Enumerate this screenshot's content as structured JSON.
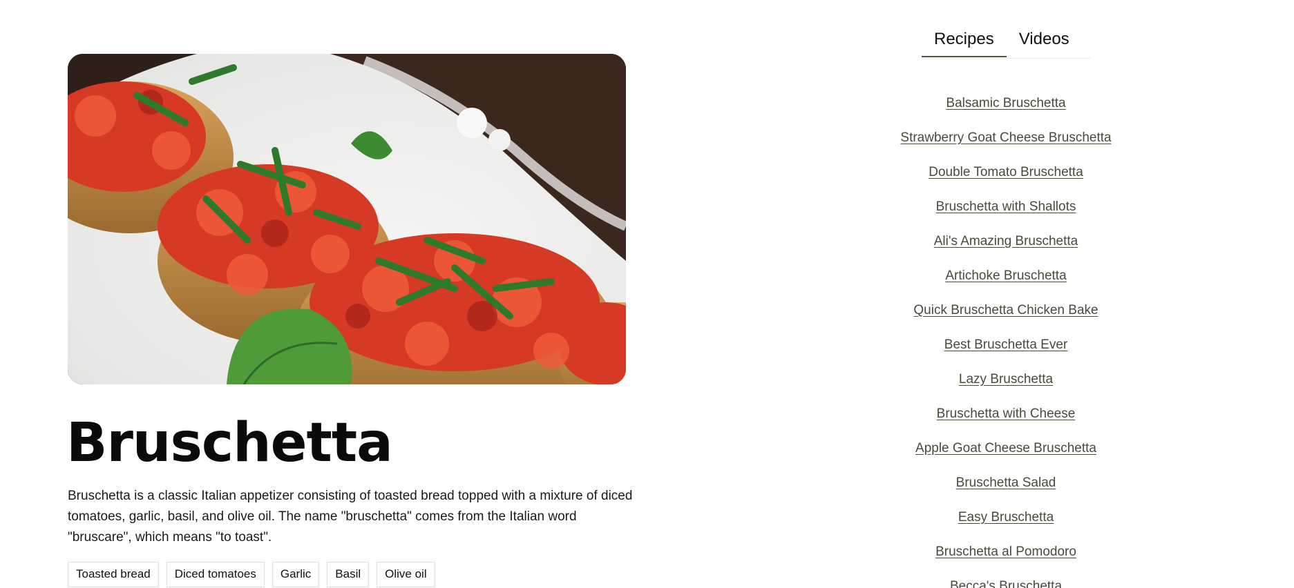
{
  "hero": {
    "alt": "Bruschetta topped with diced tomatoes and basil on a white plate"
  },
  "recipe": {
    "title": "Bruschetta",
    "description": "Bruschetta is a classic Italian appetizer consisting of toasted bread topped with a mixture of diced tomatoes, garlic, basil, and olive oil. The name \"bruschetta\" comes from the Italian word \"bruscare\", which means \"to toast\".",
    "tags": [
      "Toasted bread",
      "Diced tomatoes",
      "Garlic",
      "Basil",
      "Olive oil"
    ]
  },
  "sidebar": {
    "tabs": [
      {
        "label": "Recipes",
        "active": true
      },
      {
        "label": "Videos",
        "active": false
      }
    ],
    "recipes": [
      "Balsamic Bruschetta",
      "Strawberry Goat Cheese Bruschetta",
      "Double Tomato Bruschetta",
      "Bruschetta with Shallots",
      "Ali's Amazing Bruschetta",
      "Artichoke Bruschetta",
      "Quick Bruschetta Chicken Bake",
      "Best Bruschetta Ever",
      "Lazy Bruschetta",
      "Bruschetta with Cheese",
      "Apple Goat Cheese Bruschetta",
      "Bruschetta Salad",
      "Easy Bruschetta",
      "Bruschetta al Pomodoro",
      "Becca's Bruschetta"
    ]
  },
  "colors": {
    "tab_underline": "#4a5a3c",
    "link": "#4a4a3a"
  }
}
